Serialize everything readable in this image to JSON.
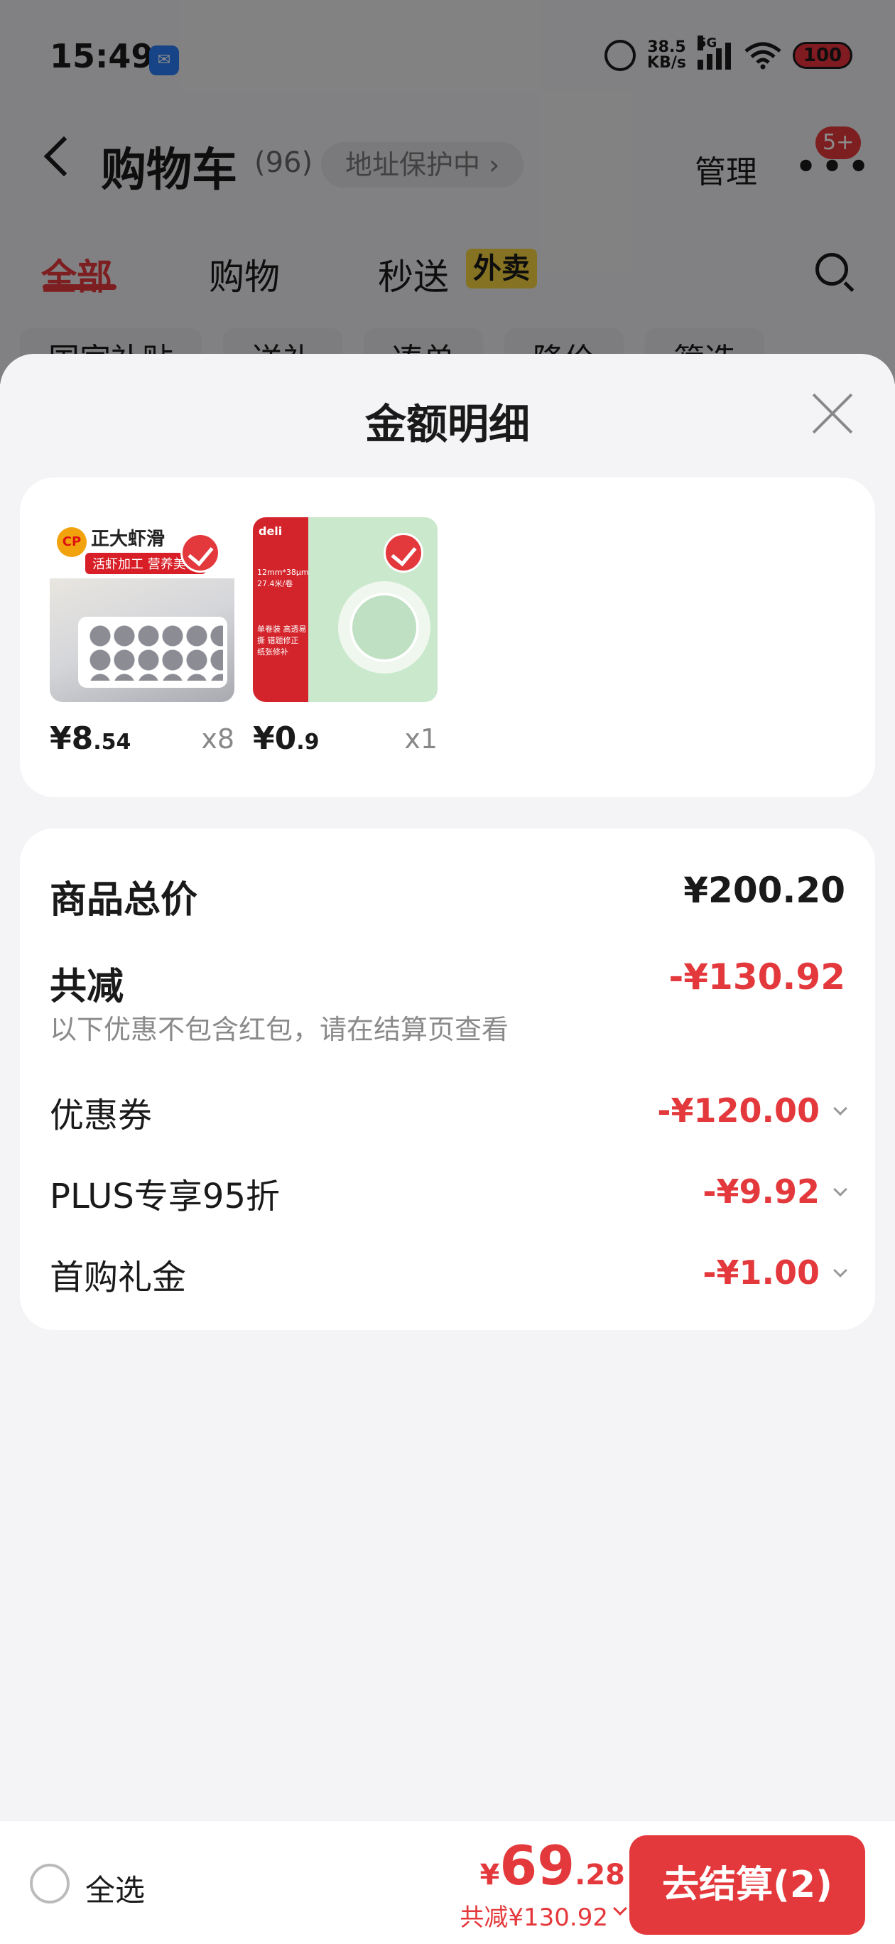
{
  "status_bar": {
    "time": "15:49",
    "net_speed_value": "38.5",
    "net_speed_unit": "KB/s",
    "signal_label": "5G",
    "battery": "100"
  },
  "header": {
    "title": "购物车",
    "count": "(96)",
    "address_protection": "地址保护中 ›",
    "manage_label": "管理",
    "message_badge": "5+"
  },
  "tabs": [
    {
      "label": "全部",
      "active": true
    },
    {
      "label": "购物",
      "active": false
    },
    {
      "label": "秒送",
      "active": false
    }
  ],
  "tab_badge": "外卖",
  "filters": [
    "国家补贴",
    "送礼",
    "凑单",
    "降价",
    "筛选"
  ],
  "sheet": {
    "title": "金额明细",
    "products": [
      {
        "brand": "CP",
        "name": "正大虾滑",
        "tag": "活虾加工 营养美味",
        "price_int": "¥8",
        "price_dec": ".54",
        "qty": "x8",
        "checked": true
      },
      {
        "brand": "deli",
        "spec": "12mm*38μm 27.4米/卷",
        "side_text": "单卷装 高透易撕 错题修正 纸张修补",
        "price_int": "¥0",
        "price_dec": ".9",
        "qty": "x1",
        "checked": true
      }
    ],
    "summary": {
      "total_label": "商品总价",
      "total_value": "¥200.20",
      "reduce_label": "共减",
      "reduce_value": "-¥130.92",
      "reduce_note": "以下优惠不包含红包，请在结算页查看",
      "discounts": [
        {
          "label": "优惠券",
          "value": "-¥120.00"
        },
        {
          "label": "PLUS专享95折",
          "value": "-¥9.92"
        },
        {
          "label": "首购礼金",
          "value": "-¥1.00"
        }
      ]
    }
  },
  "bottom_bar": {
    "select_all": "全选",
    "currency": "¥",
    "total_int": "69",
    "total_dec": ".28",
    "saved": "共减¥130.92",
    "checkout": "去结算(2)"
  },
  "colors": {
    "accent": "#e4393c",
    "badge_yellow": "#f3d03e",
    "sheet_bg": "#f4f4f6"
  }
}
